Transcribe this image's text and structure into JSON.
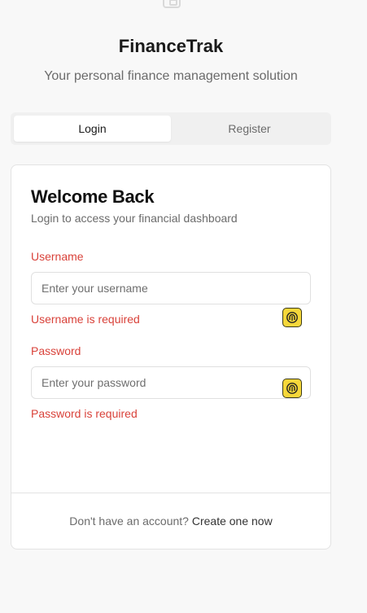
{
  "app": {
    "title": "FinanceTrak",
    "subtitle": "Your personal finance management solution"
  },
  "tabs": [
    {
      "label": "Login",
      "active": true
    },
    {
      "label": "Register",
      "active": false
    }
  ],
  "card": {
    "title": "Welcome Back",
    "description": "Login to access your financial dashboard"
  },
  "form": {
    "username": {
      "label": "Username",
      "placeholder": "Enter your username",
      "value": "",
      "error": "Username is required"
    },
    "password": {
      "label": "Password",
      "placeholder": "Enter your password",
      "value": "",
      "error": "Password is required"
    }
  },
  "footer": {
    "prompt": "Don't have an account?",
    "link": "Create one now"
  },
  "colors": {
    "error": "#d9423a",
    "background": "#f8f8f8",
    "card": "#ffffff",
    "extension_icon": "#f5d73a"
  },
  "icons": {
    "logo": "wallet-icon",
    "field_addon": "password-manager-icon"
  }
}
